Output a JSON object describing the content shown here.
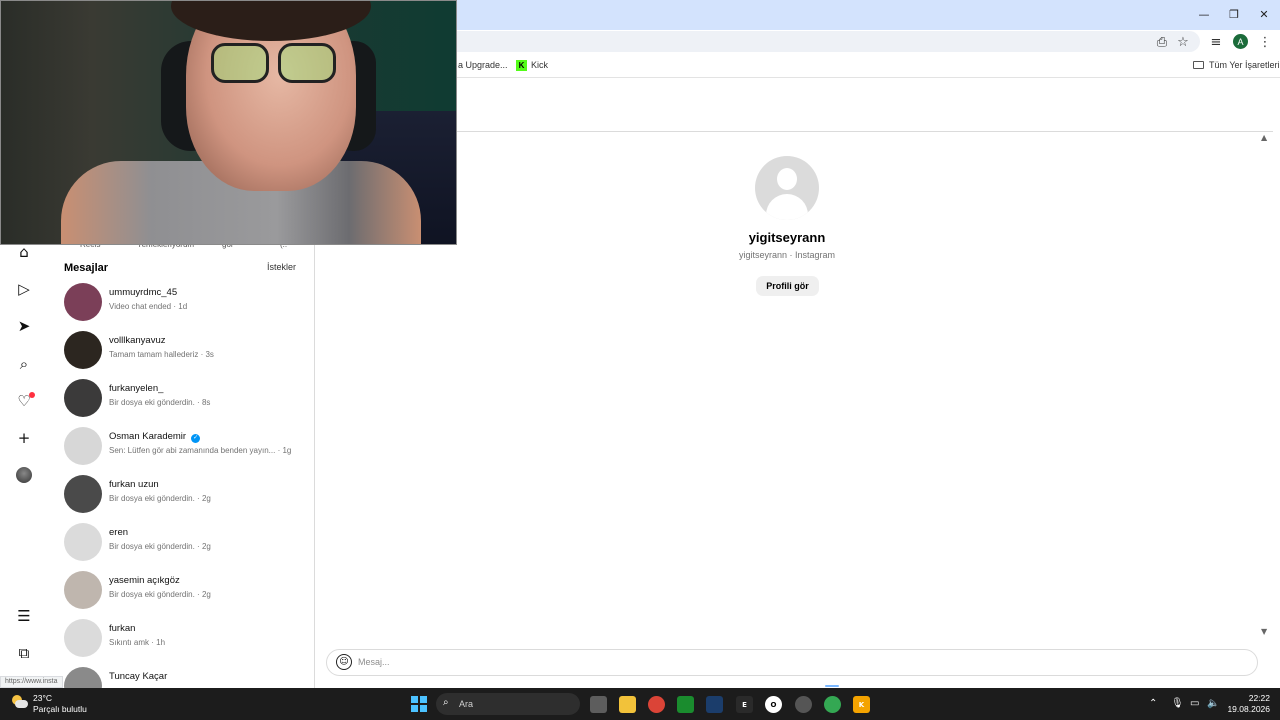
{
  "browser": {
    "bookmarks": {
      "upgrade_label": "a Upgrade...",
      "kick_label": "Kick",
      "all_bookmarks_label": "Tüm Yer İşaretleri"
    },
    "profile_initial": "A",
    "status_url": "https://www.insta"
  },
  "side_panel": {
    "peek_labels": [
      "Reels",
      "Yemekleriyorum",
      "gör",
      "(.."
    ],
    "title": "Mesajlar",
    "requests_label": "İstekler",
    "conversations": [
      {
        "name": "ummuyrdmc_45",
        "preview": "Video chat ended · 1d",
        "avatar_color": "#7b3f58"
      },
      {
        "name": "volllkanyavuz",
        "preview": "Tamam tamam hallederiz · 3s",
        "avatar_color": "#2c2620"
      },
      {
        "name": "furkanyelen_",
        "preview": "Bir dosya eki gönderdin. · 8s",
        "avatar_color": "#3b3a3a"
      },
      {
        "name": "Osman Karademir",
        "preview": "Sen: Lütfen gör abi zamanında benden yayın... · 1g",
        "avatar_color": "#d7d7d7",
        "verified": true
      },
      {
        "name": "furkan uzun",
        "preview": "Bir dosya eki gönderdin. · 2g",
        "avatar_color": "#4a4a4a"
      },
      {
        "name": "eren",
        "preview": "Bir dosya eki gönderdin. · 2g",
        "avatar_color": "#dbdbdb"
      },
      {
        "name": "yasemin açıkgöz",
        "preview": "Bir dosya eki gönderdin. · 2g",
        "avatar_color": "#bfb6ae"
      },
      {
        "name": "furkan",
        "preview": "Sıkıntı amk · 1h",
        "avatar_color": "#dbdbdb"
      },
      {
        "name": "Tuncay Kaçar",
        "preview": "",
        "avatar_color": "#8a8a8a"
      }
    ]
  },
  "chat": {
    "profile_name": "yigitseyrann",
    "profile_sub": "yigitseyrann · Instagram",
    "view_profile_label": "Profili gör",
    "composer_placeholder": "Mesaj..."
  },
  "taskbar": {
    "temperature": "23°C",
    "condition": "Parçalı bulutlu",
    "search_label": "Ara",
    "time": "22:22",
    "date": "19.08.2026"
  },
  "icons": {
    "nav": [
      "home-icon",
      "reels-icon",
      "messages-icon",
      "search-icon",
      "notifications-icon",
      "create-icon"
    ],
    "accent_colors": {
      "notification": "#ff3040",
      "verified": "#0095f6",
      "kick": "#53fc18"
    }
  }
}
